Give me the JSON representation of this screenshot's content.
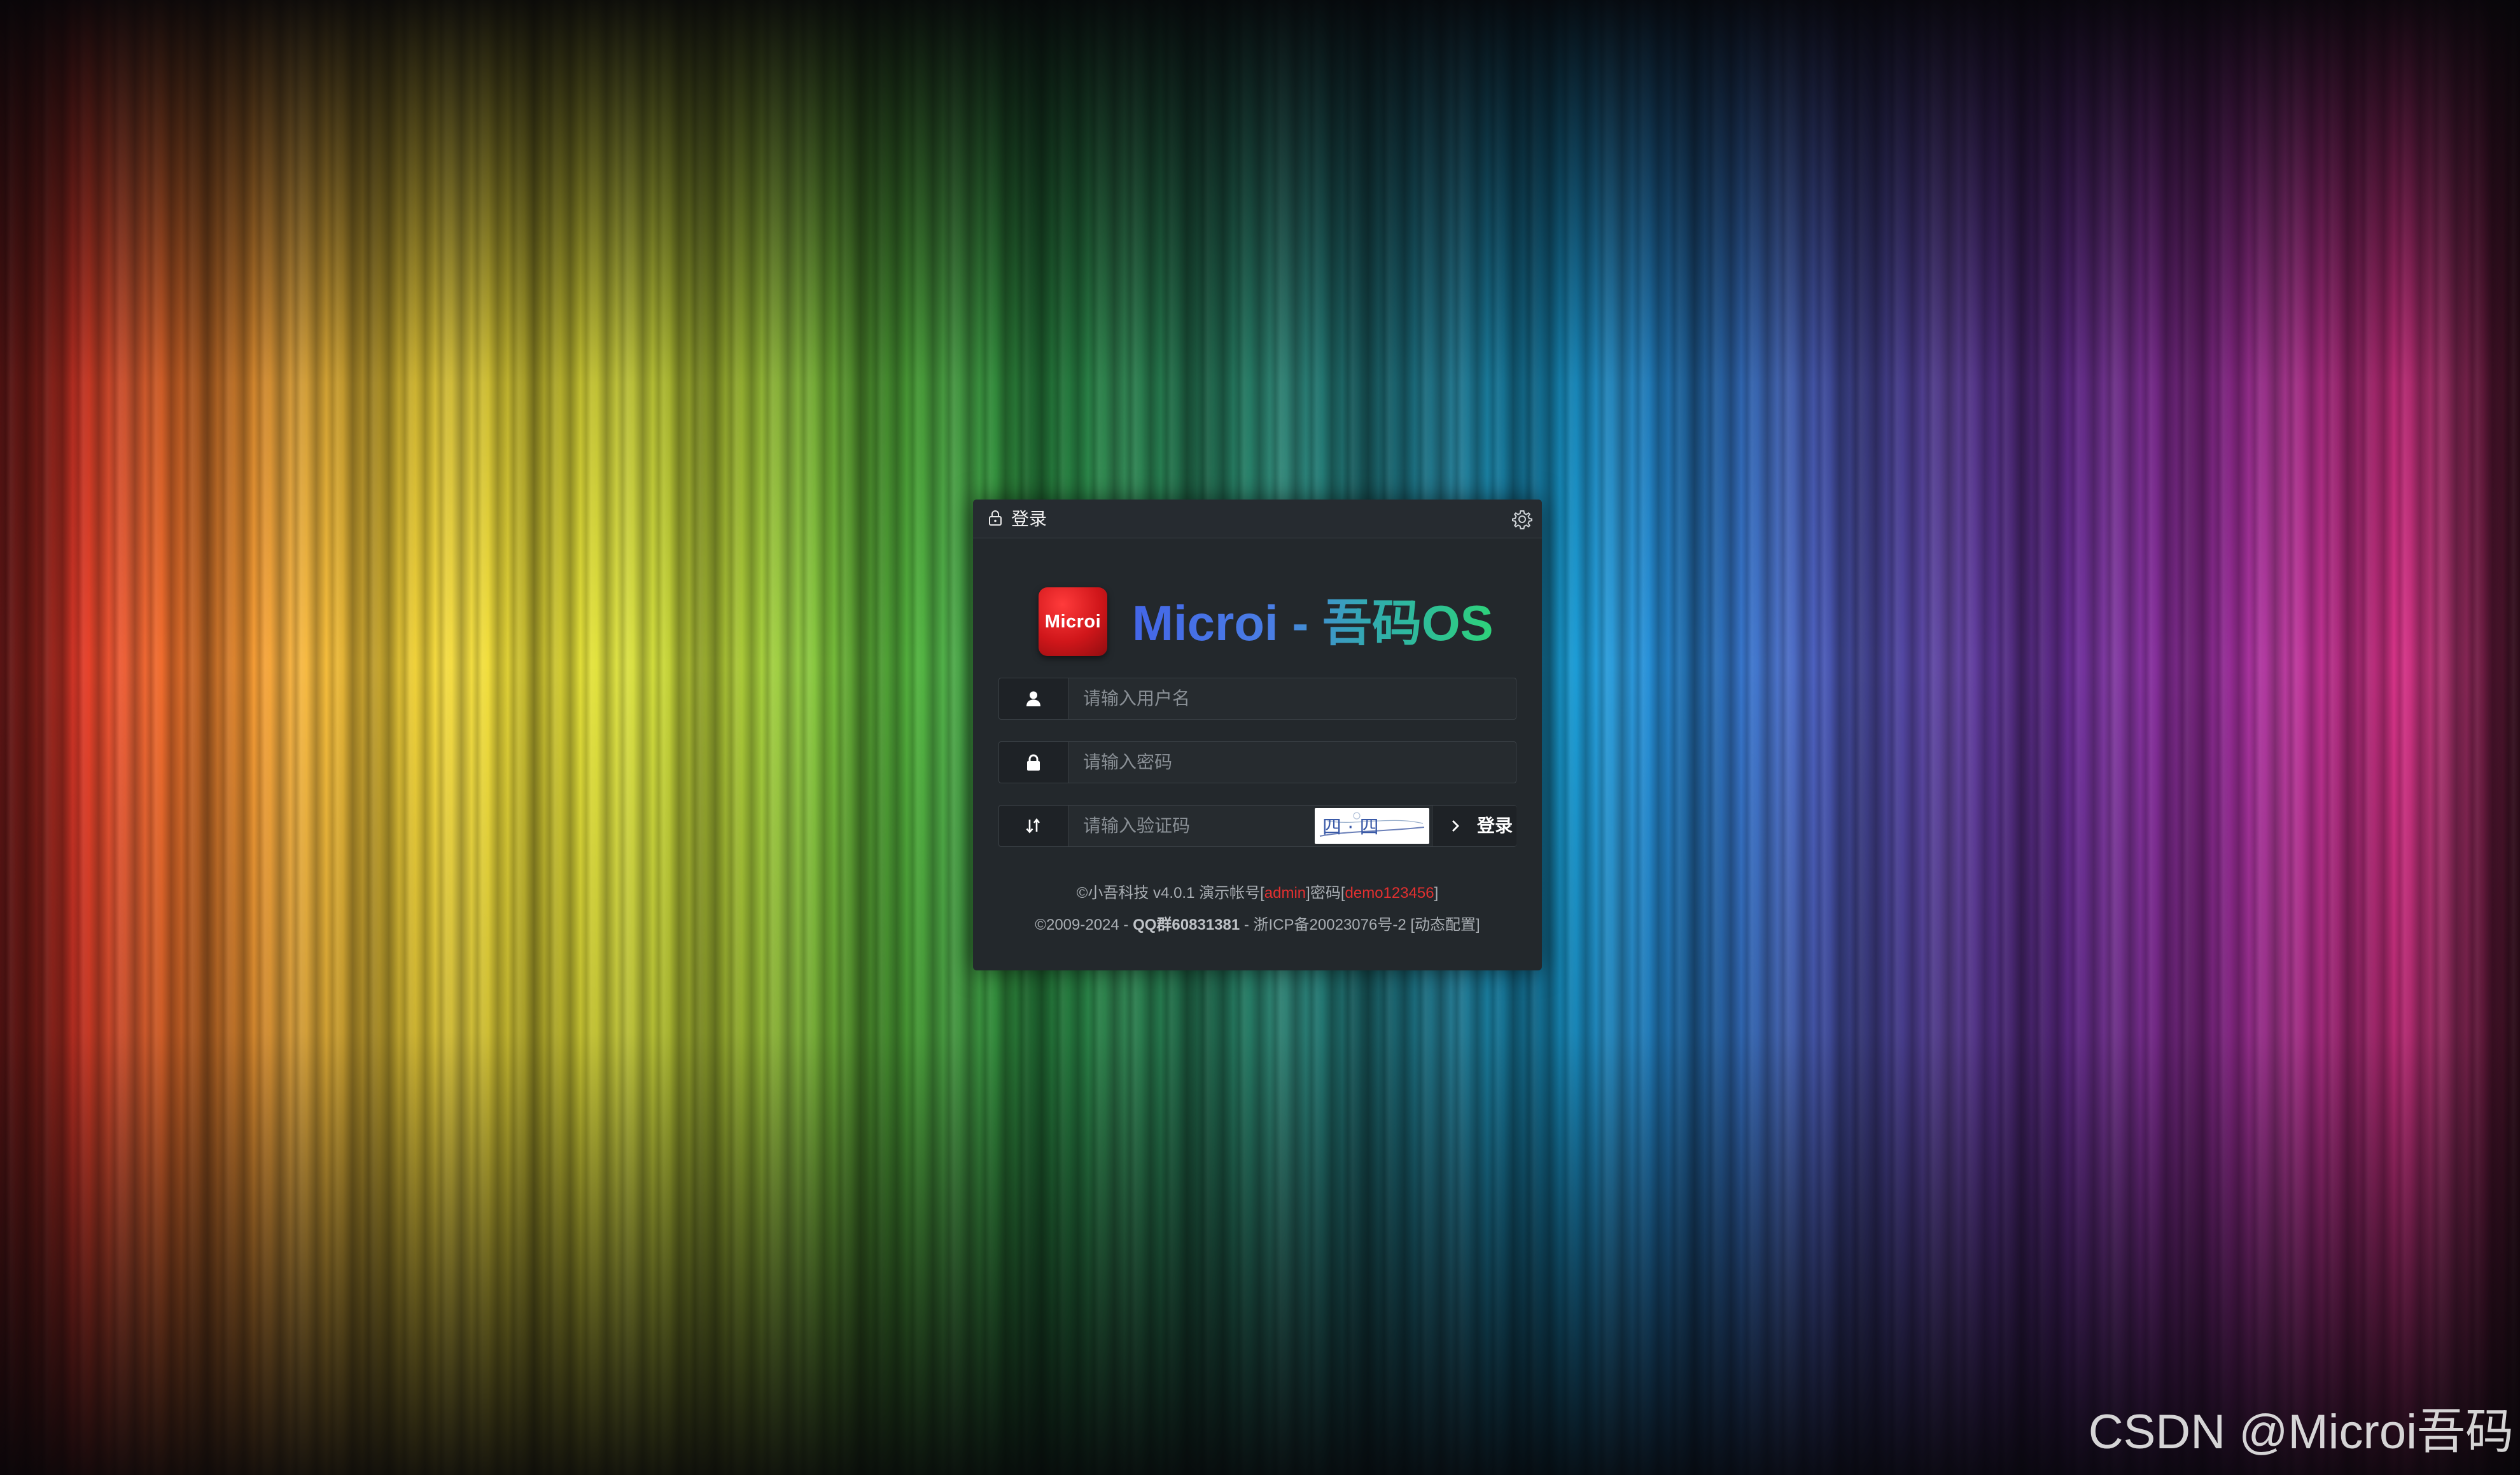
{
  "panel": {
    "title": "登录"
  },
  "brand": {
    "logo_text": "Microi",
    "title": "Microi - 吾码OS"
  },
  "form": {
    "username_placeholder": "请输入用户名",
    "password_placeholder": "请输入密码",
    "captcha_placeholder": "请输入验证码",
    "captcha_text": "四 · 四",
    "login_label": "登录"
  },
  "footer": {
    "line1_prefix": "©小吾科技 v4.0.1 演示帐号[",
    "demo_account": "admin",
    "line1_mid": "]密码[",
    "demo_password": "demo123456",
    "line1_suffix": "]",
    "line2_prefix": "©2009-2024 - ",
    "qq_group": "QQ群60831381",
    "line2_mid": " - 浙ICP备20023076号-2 ",
    "dynamic_config": "[动态配置]"
  },
  "watermark": "CSDN @Microi吾码",
  "icons": {
    "header": "lock-icon",
    "settings": "gear-icon",
    "username": "user-icon",
    "password": "lock-icon",
    "captcha": "sort-icon",
    "login": "chevron-right-icon"
  },
  "colors": {
    "panel_bg": "#23282c",
    "addon_bg": "#1e2226",
    "highlight_red": "#e23030",
    "logo_red": "#d0161a",
    "brand_blue": "#4466e8",
    "brand_green": "#2ed27a"
  }
}
